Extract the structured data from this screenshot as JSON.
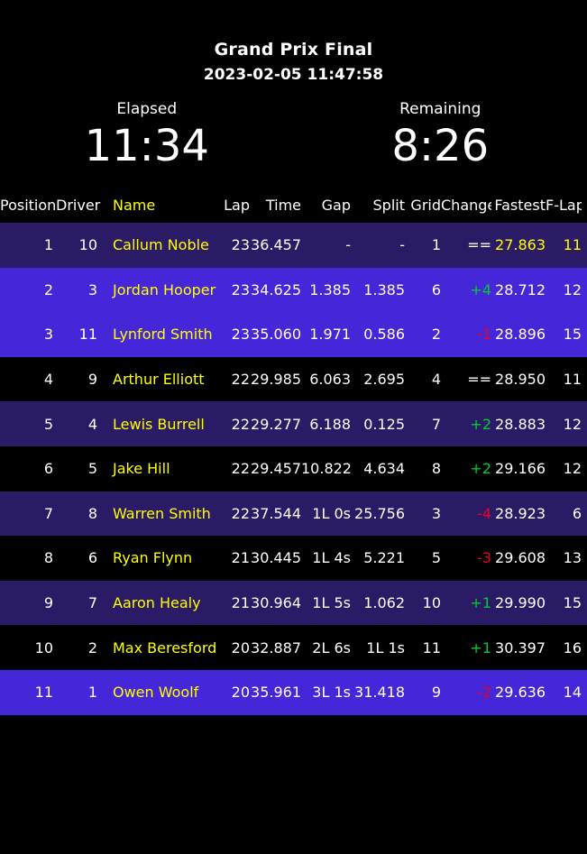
{
  "header": {
    "race_title": "Grand Prix Final",
    "datetime": "2023-02-05 11:47:58"
  },
  "clocks": {
    "elapsed_label": "Elapsed",
    "elapsed_value": "11:34",
    "remaining_label": "Remaining",
    "remaining_value": "8:26"
  },
  "colors": {
    "name_accent": "#ffff00",
    "best_lap": "#ffff00",
    "gain": "#00cc33",
    "loss": "#ee0022",
    "row_dark": "#2b1a66",
    "row_bright": "#4526d8",
    "row_black": "#000000",
    "text": "#ffffff"
  },
  "table": {
    "columns": [
      "Position",
      "Driver",
      "Name",
      "Lap",
      "Time",
      "Gap",
      "Split",
      "Grid",
      "Change",
      "Fastest",
      "F-Lap"
    ],
    "rows": [
      {
        "position": "1",
        "driver": "10",
        "name": "Callum Noble",
        "lap": "23",
        "time": "36.457",
        "gap": "-",
        "split": "-",
        "grid": "1",
        "change": "==",
        "change_dir": "same",
        "fastest": "27.863",
        "flap": "11",
        "row_bg": "dark",
        "best_lap": true
      },
      {
        "position": "2",
        "driver": "3",
        "name": "Jordan Hooper",
        "lap": "23",
        "time": "34.625",
        "gap": "1.385",
        "split": "1.385",
        "grid": "6",
        "change": "+4",
        "change_dir": "up",
        "fastest": "28.712",
        "flap": "12",
        "row_bg": "bright",
        "best_lap": false
      },
      {
        "position": "3",
        "driver": "11",
        "name": "Lynford Smith",
        "lap": "23",
        "time": "35.060",
        "gap": "1.971",
        "split": "0.586",
        "grid": "2",
        "change": "-1",
        "change_dir": "down",
        "fastest": "28.896",
        "flap": "15",
        "row_bg": "bright",
        "best_lap": false
      },
      {
        "position": "4",
        "driver": "9",
        "name": "Arthur Elliott",
        "lap": "22",
        "time": "29.985",
        "gap": "6.063",
        "split": "2.695",
        "grid": "4",
        "change": "==",
        "change_dir": "same",
        "fastest": "28.950",
        "flap": "11",
        "row_bg": "black",
        "best_lap": false
      },
      {
        "position": "5",
        "driver": "4",
        "name": "Lewis Burrell",
        "lap": "22",
        "time": "29.277",
        "gap": "6.188",
        "split": "0.125",
        "grid": "7",
        "change": "+2",
        "change_dir": "up",
        "fastest": "28.883",
        "flap": "12",
        "row_bg": "dark",
        "best_lap": false
      },
      {
        "position": "6",
        "driver": "5",
        "name": "Jake Hill",
        "lap": "22",
        "time": "29.457",
        "gap": "10.822",
        "split": "4.634",
        "grid": "8",
        "change": "+2",
        "change_dir": "up",
        "fastest": "29.166",
        "flap": "12",
        "row_bg": "black",
        "best_lap": false
      },
      {
        "position": "7",
        "driver": "8",
        "name": "Warren Smith",
        "lap": "22",
        "time": "37.544",
        "gap": "1L 0s",
        "split": "25.756",
        "grid": "3",
        "change": "-4",
        "change_dir": "down",
        "fastest": "28.923",
        "flap": "6",
        "row_bg": "dark",
        "best_lap": false
      },
      {
        "position": "8",
        "driver": "6",
        "name": "Ryan Flynn",
        "lap": "21",
        "time": "30.445",
        "gap": "1L 4s",
        "split": "5.221",
        "grid": "5",
        "change": "-3",
        "change_dir": "down",
        "fastest": "29.608",
        "flap": "13",
        "row_bg": "black",
        "best_lap": false
      },
      {
        "position": "9",
        "driver": "7",
        "name": "Aaron Healy",
        "lap": "21",
        "time": "30.964",
        "gap": "1L 5s",
        "split": "1.062",
        "grid": "10",
        "change": "+1",
        "change_dir": "up",
        "fastest": "29.990",
        "flap": "15",
        "row_bg": "dark",
        "best_lap": false
      },
      {
        "position": "10",
        "driver": "2",
        "name": "Max Beresford",
        "lap": "20",
        "time": "32.887",
        "gap": "2L 6s",
        "split": "1L 1s",
        "grid": "11",
        "change": "+1",
        "change_dir": "up",
        "fastest": "30.397",
        "flap": "16",
        "row_bg": "black",
        "best_lap": false
      },
      {
        "position": "11",
        "driver": "1",
        "name": "Owen Woolf",
        "lap": "20",
        "time": "35.961",
        "gap": "3L 1s",
        "split": "31.418",
        "grid": "9",
        "change": "-2",
        "change_dir": "down",
        "fastest": "29.636",
        "flap": "14",
        "row_bg": "bright",
        "best_lap": false
      }
    ]
  }
}
